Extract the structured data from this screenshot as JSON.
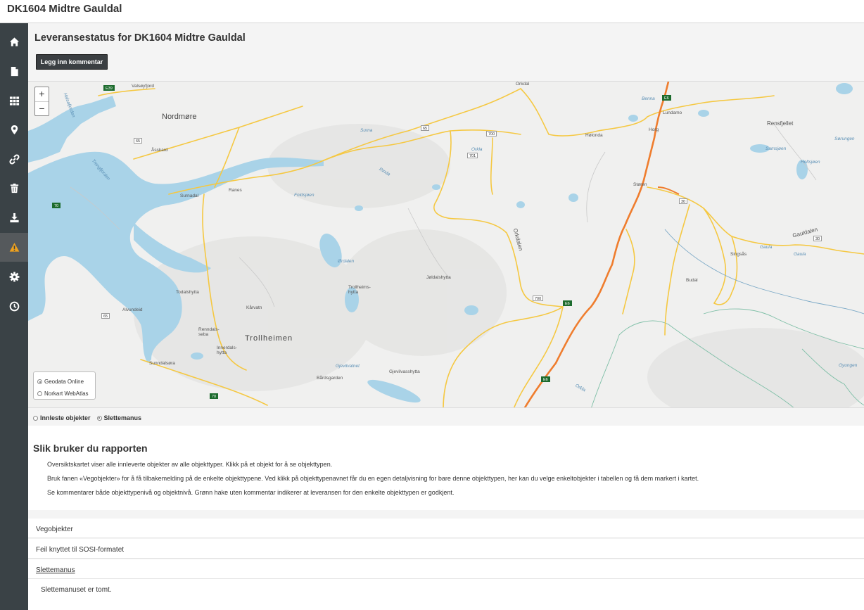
{
  "app": {
    "title": "DK1604 Midtre Gauldal"
  },
  "sidebar": {
    "items": [
      {
        "icon": "home-icon"
      },
      {
        "icon": "document-icon"
      },
      {
        "icon": "grid-icon"
      },
      {
        "icon": "map-marker-icon"
      },
      {
        "icon": "link-icon"
      },
      {
        "icon": "trash-icon"
      },
      {
        "icon": "download-icon"
      },
      {
        "icon": "warning-icon",
        "active": true
      },
      {
        "icon": "gear-icon"
      },
      {
        "icon": "clock-icon"
      }
    ],
    "warning_color": "#f0a21e"
  },
  "main": {
    "title": "Leveransestatus for DK1604 Midtre Gauldal",
    "comment_button": "Legg inn kommentar"
  },
  "map": {
    "zoom_in": "+",
    "zoom_out": "−",
    "base_layers": [
      {
        "label": "Geodata Online",
        "selected": true
      },
      {
        "label": "Norkart WebAtlas",
        "selected": false
      }
    ],
    "labels": {
      "nordmore": "Nordmøre",
      "trollheimen": "Trollheimen",
      "gauldalen": "Gauldalen",
      "orkdalen": "Orkdalen",
      "rensfjellet": "Rensfjellet",
      "valsoyfjord": "Valsøyfjord",
      "halsafjorden": "Halsafjorden",
      "aasskard": "Åsskard",
      "surnadal": "Surnadal",
      "ranes": "Ranes",
      "todalshytta": "Todalshytta",
      "kaarvatn": "Kårvatn",
      "renndalsseba": "Renndals-seba",
      "innerdalshytta": "Innerdals-hytta",
      "trollheimshytta": "Trollheims-hytta",
      "joldalshytta": "Jøldalshytta",
      "gjevilvasshytta": "Gjevilvasshytta",
      "gjevilvatnet": "Gjevilvatnet",
      "baardsgarden": "Bårdsgarden",
      "sunndalsora": "Sunndalsøra",
      "alvundeid": "Alvundeid",
      "ordalen": "Ørdalen",
      "folddalsvatn": "Foldsjøen",
      "surna": "Surna",
      "rinda": "Rinda",
      "orkla": "Orkla",
      "orkla2": "Orkla",
      "orkdal": "Orkdal",
      "lundamo": "Lundamo",
      "horg": "Horg",
      "hølonda": "Hølonda",
      "storen": "Støren",
      "singsas": "Singsås",
      "budal": "Budal",
      "gaula": "Gaula",
      "gaula2": "Gaula",
      "samsjoen": "Samsjøen",
      "holtsjoen": "Holtsjøen",
      "sorungen": "Sørungen",
      "gyungen": "Gyungen",
      "benna": "Benna",
      "trongfjorden": "Trongfjorden"
    },
    "shields": {
      "e39": "E39",
      "r65a": "65",
      "r65b": "65",
      "r65c": "65",
      "r70a": "70",
      "r70b": "70",
      "r700a": "700",
      "r700b": "700",
      "r701": "701",
      "e6a": "E6",
      "e6b": "E6",
      "e6c": "E6",
      "r30": "30",
      "r30b": "30"
    }
  },
  "layer_toggle": {
    "options": [
      {
        "label": "Innleste objekter",
        "selected": false
      },
      {
        "label": "Slettemanus",
        "selected": true
      }
    ]
  },
  "help": {
    "heading": "Slik bruker du rapporten",
    "lines": [
      "Oversiktskartet viser alle innleverte objekter av alle objekttyper. Klikk på et objekt for å se objekttypen.",
      "Bruk fanen «Vegobjekter» for å få tilbakemelding på de enkelte objekttypene. Ved klikk på objekttypenavnet får du en egen detaljvisning for bare denne objekttypen, her kan du velge enkeltobjekter i tabellen og få dem markert i kartet.",
      "Se kommentarer både objekttypenivå og objektnivå. Grønn hake uten kommentar indikerer at leveransen for den enkelte objekttypen er godkjent."
    ]
  },
  "accordion": {
    "vegobjekter": "Vegobjekter",
    "sosi": "Feil knyttet til SOSI-formatet",
    "slettemanus": "Slettemanus",
    "slettemanus_body": "Slettemanuset er tomt."
  }
}
